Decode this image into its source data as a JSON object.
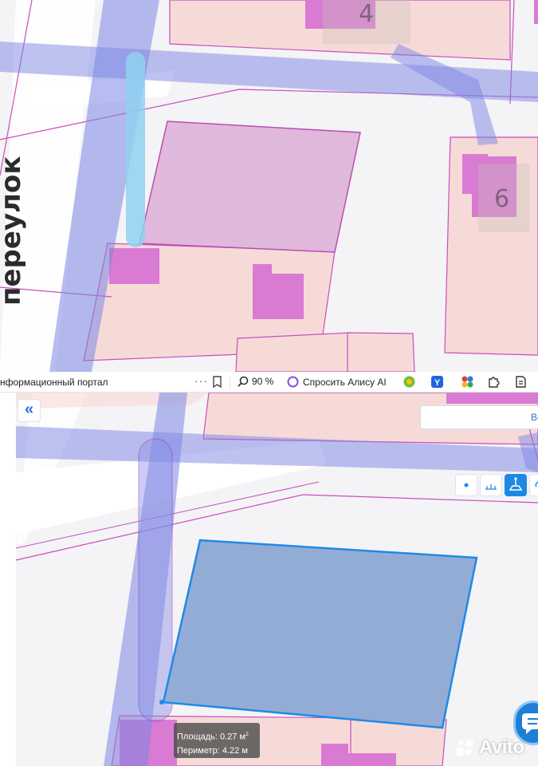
{
  "map_top": {
    "house_numbers": [
      "4",
      "6"
    ],
    "street_label": "переулок"
  },
  "browser_toolbar": {
    "page_title": "нформационный портал",
    "more_icon": "more-dots-icon",
    "bookmark_icon": "bookmark-icon",
    "zoom_icon": "zoom-icon",
    "zoom_level": "90 %",
    "alice_label": "Спросить Алису AI",
    "alice_icon": "alice-icon",
    "extension_icons": [
      "gear-extension-icon",
      "yandex-extension-icon",
      "multicolor-extension-icon",
      "puzzle-extension-icon",
      "page-extension-icon"
    ]
  },
  "map_controls": {
    "collapse_label": "«",
    "search_button_text": "Во",
    "tools": [
      "point-tool-icon",
      "ruler-tool-icon",
      "area-tool-icon",
      "link-tool-icon"
    ],
    "active_tool": "area-tool-icon"
  },
  "measurement": {
    "area_label": "Площадь: 0.27 м",
    "area_superscript": "2",
    "perimeter_label": "Периметр: 4.22 м"
  },
  "chat_icon": "chat-bubble-icon",
  "watermark": {
    "text": "Avito",
    "icon": "avito-logo-icon"
  },
  "colors": {
    "parcel_fill": "#f6dad7",
    "parcel_border": "#c74fbf",
    "building_fill": "#d97ad3",
    "highlight_parcel": "#e0b8dc",
    "road_overlay": "#7b86e3",
    "pipe_overlay": "#8fd0f0",
    "measure_fill": "#93acd6",
    "measure_border": "#1e8ae6",
    "active_tool": "#1e88e5"
  }
}
